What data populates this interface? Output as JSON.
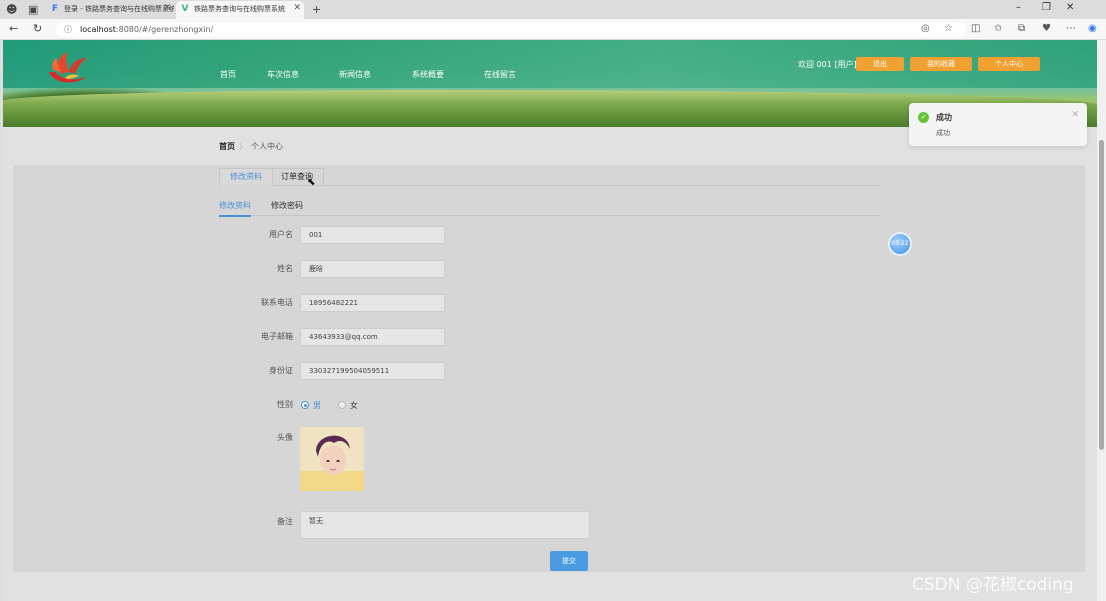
{
  "browser": {
    "tabs": [
      {
        "label": "登录 - 铁路票务查询与在线购票系统",
        "favicon": "F",
        "favicon_color": "#3b78e7"
      },
      {
        "label": "铁路票务查询与在线购票系统",
        "favicon": "V",
        "favicon_color": "#3fb27f"
      }
    ],
    "url_host": "localhost",
    "url_path": ":8080/#/gerenzhongxin/"
  },
  "header": {
    "menu": [
      "首页",
      "车次信息",
      "新闻信息",
      "系统概要",
      "在线留言"
    ],
    "welcome": "欢迎 001 [用户]",
    "buttons": {
      "logout": "退出",
      "favorites": "我的收藏",
      "profile": "个人中心"
    },
    "accent": "#f0a131"
  },
  "breadcrumb": {
    "home": "首页",
    "current": "个人中心"
  },
  "tabs": {
    "outer": [
      "修改资料",
      "订单查询"
    ],
    "inner": [
      "修改资料",
      "修改密码"
    ]
  },
  "form": {
    "username": {
      "label": "用户名",
      "value": "001"
    },
    "name": {
      "label": "姓名",
      "value": "鹿晗"
    },
    "phone": {
      "label": "联系电话",
      "value": "18956482221"
    },
    "email": {
      "label": "电子邮箱",
      "value": "43643933@qq.com"
    },
    "idcard": {
      "label": "身份证",
      "value": "330327199504059511"
    },
    "gender": {
      "label": "性别",
      "options": [
        "男",
        "女"
      ],
      "selected": "男"
    },
    "avatar_label": "头像",
    "remark": {
      "label": "备注",
      "value": "暂无"
    },
    "submit": "提交"
  },
  "float_ball": "03:22",
  "toast": {
    "title": "成功",
    "message": "成功"
  },
  "watermark": "CSDN @花椒coding"
}
